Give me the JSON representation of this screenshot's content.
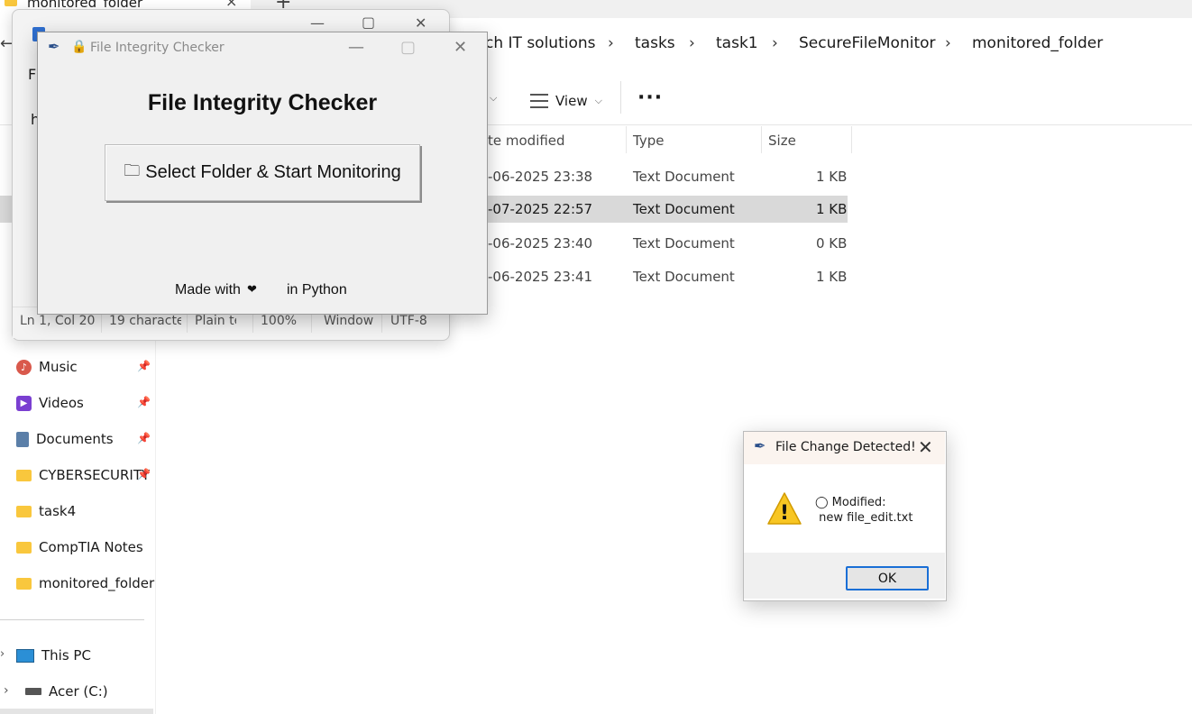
{
  "explorer": {
    "tab_title": "monitored_folder",
    "tab_close": "×",
    "tab_new": "+",
    "breadcrumb": [
      "ch IT solutions",
      "tasks",
      "task1",
      "SecureFileMonitor",
      "monitored_folder"
    ],
    "chevron": "›",
    "toolbar": {
      "sort_caret": "⌵",
      "view_label": "View",
      "view_caret": "⌵",
      "more": "···"
    },
    "columns": {
      "date": "te modified",
      "type": "Type",
      "size": "Size"
    },
    "rows": [
      {
        "date": "-06-2025 23:38",
        "type": "Text Document",
        "size": "1 KB"
      },
      {
        "date": "-07-2025 22:57",
        "type": "Text Document",
        "size": "1 KB"
      },
      {
        "date": "-06-2025 23:40",
        "type": "Text Document",
        "size": "0 KB"
      },
      {
        "date": "-06-2025 23:41",
        "type": "Text Document",
        "size": "1 KB"
      }
    ],
    "nav": {
      "music": "Music",
      "videos": "Videos",
      "documents": "Documents",
      "cyber": "CYBERSECURITY",
      "task4": "task4",
      "comptia": "CompTIA Notes",
      "monitored": "monitored_folder",
      "thispc": "This PC",
      "drive": "Acer (C:)",
      "pin": "📌"
    },
    "folder_color": "#f9c73d"
  },
  "notepad": {
    "menu_letter": "F",
    "line2_letter": "h",
    "min": "—",
    "max": "▢",
    "close": "✕",
    "status": [
      "Ln 1, Col 20",
      "19 characte",
      "Plain te",
      "100%",
      "Window",
      "UTF-8"
    ]
  },
  "tk_app": {
    "window_title": "File Integrity Checker",
    "heading": "File Integrity Checker",
    "button_icon": "🗀",
    "button_label": "Select Folder & Start Monitoring",
    "footer_left": "Made with",
    "footer_heart": "❤",
    "footer_right": "in Python",
    "min": "—",
    "max": "▢",
    "close": "✕"
  },
  "dialog": {
    "title": "File Change Detected!",
    "close": "✕",
    "message": "◯ Modified:\n new file_edit.txt",
    "ok": "OK",
    "warning_icon": "!"
  }
}
